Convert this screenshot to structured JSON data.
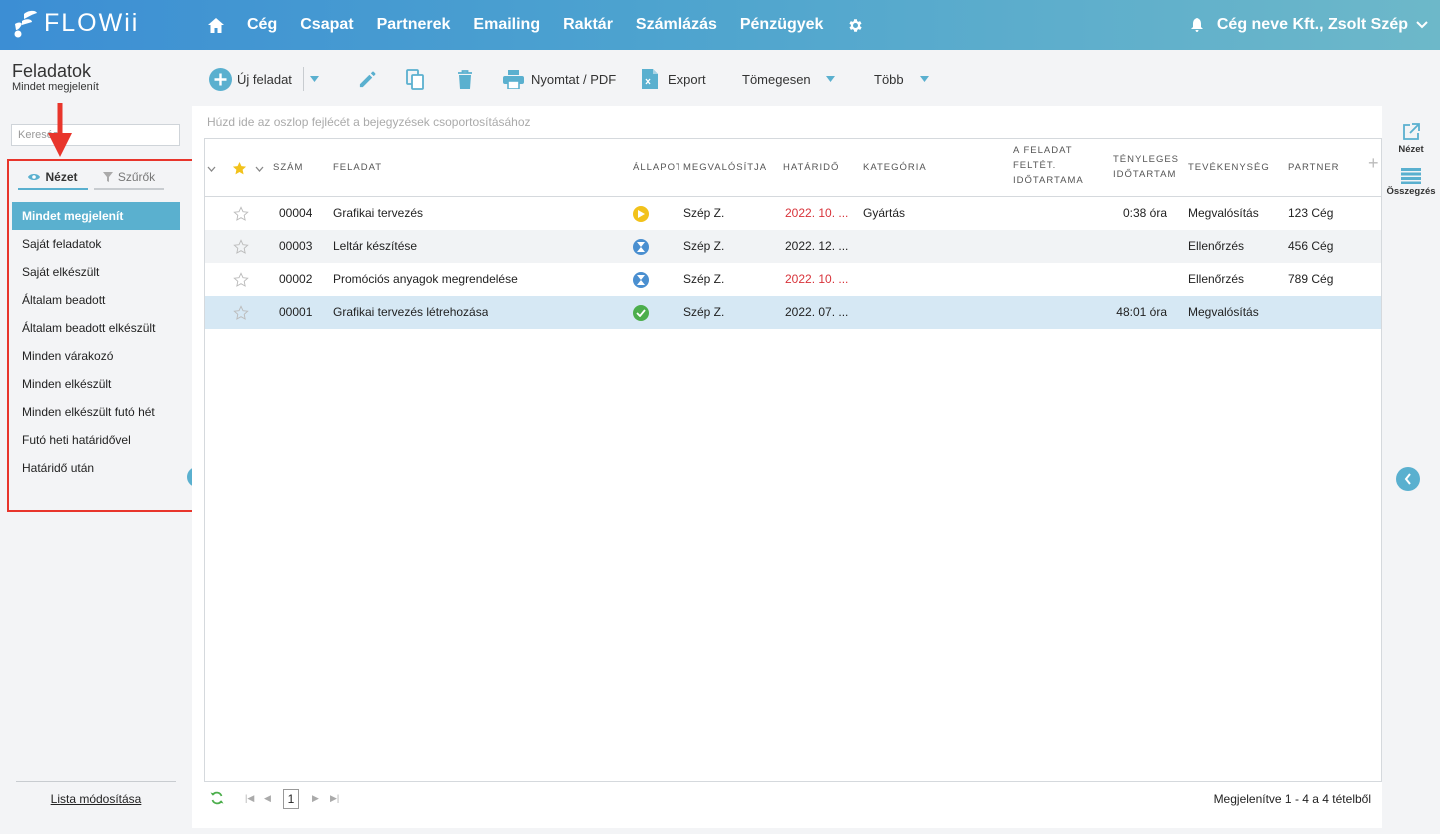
{
  "brand": {
    "name": "FLOWii"
  },
  "nav": {
    "items": [
      {
        "label": "Cég",
        "name": "nav-ceg"
      },
      {
        "label": "Csapat",
        "name": "nav-csapat"
      },
      {
        "label": "Partnerek",
        "name": "nav-partnerek"
      },
      {
        "label": "Emailing",
        "name": "nav-emailing"
      },
      {
        "label": "Raktár",
        "name": "nav-raktar"
      },
      {
        "label": "Számlázás",
        "name": "nav-szamlazas"
      },
      {
        "label": "Pénzügyek",
        "name": "nav-penzugyek"
      }
    ],
    "user": "Cég neve Kft., Zsolt Szép"
  },
  "page": {
    "title": "Feladatok",
    "subtitle": "Mindet megjelenít"
  },
  "sidebar": {
    "search_placeholder": "Keresés",
    "tabs": {
      "view": "Nézet",
      "filters": "Szűrők"
    },
    "views": [
      "Mindet megjelenít",
      "Saját feladatok",
      "Saját elkészült",
      "Általam beadott",
      "Általam beadott elkészült",
      "Minden várakozó",
      "Minden elkészült",
      "Minden elkészült futó hét",
      "Futó heti határidővel",
      "Határidő után"
    ],
    "list_modify": "Lista módosítása"
  },
  "toolbar": {
    "new_task": "Új feladat",
    "print": "Nyomtat / PDF",
    "export": "Export",
    "bulk": "Tömegesen",
    "more": "Több"
  },
  "grid": {
    "group_hint": "Húzd ide az oszlop fejlécét a bejegyzések csoportosításához",
    "headers": {
      "number": "Szám",
      "task": "Feladat",
      "status": "Állapot",
      "assignee": "Megvalósítja",
      "deadline": "Határidő",
      "category": "Kategória",
      "est_duration_1": "A feladat",
      "est_duration_2": "feltét.",
      "est_duration_3": "időtartama",
      "actual_duration_1": "Tényleges",
      "actual_duration_2": "időtartam",
      "activity": "Tevékenység",
      "partner": "Partner"
    },
    "rows": [
      {
        "number": "00004",
        "task": "Grafikai tervezés",
        "status": "in-progress",
        "assignee": "Szép Z.",
        "deadline": "2022. 10. ...",
        "deadline_overdue": true,
        "category": "Gyártás",
        "actual": "0:38 óra",
        "activity": "Megvalósítás",
        "partner": "123 Cég"
      },
      {
        "number": "00003",
        "task": "Leltár készítése",
        "status": "waiting",
        "assignee": "Szép Z.",
        "deadline": "2022. 12. ...",
        "deadline_overdue": false,
        "category": "",
        "actual": "",
        "activity": "Ellenőrzés",
        "partner": "456 Cég"
      },
      {
        "number": "00002",
        "task": "Promóciós anyagok megrendelése",
        "status": "waiting",
        "assignee": "Szép Z.",
        "deadline": "2022. 10. ...",
        "deadline_overdue": true,
        "category": "",
        "actual": "",
        "activity": "Ellenőrzés",
        "partner": "789 Cég"
      },
      {
        "number": "00001",
        "task": "Grafikai tervezés létrehozása",
        "status": "done",
        "assignee": "Szép Z.",
        "deadline": "2022. 07. ...",
        "deadline_overdue": false,
        "category": "",
        "actual": "48:01 óra",
        "activity": "Megvalósítás",
        "partner": ""
      }
    ],
    "status_colors": {
      "in-progress": "#f2c21b",
      "waiting": "#4a8fd0",
      "done": "#4cae4c"
    }
  },
  "pager": {
    "page": "1",
    "info": "Megjelenítve 1 - 4 a 4 tételből"
  },
  "rightrail": {
    "view": "Nézet",
    "summary": "Összegzés"
  },
  "colors": {
    "accent": "#5ab0cf",
    "highlight": "#e8352b",
    "overdue": "#d8333a"
  }
}
